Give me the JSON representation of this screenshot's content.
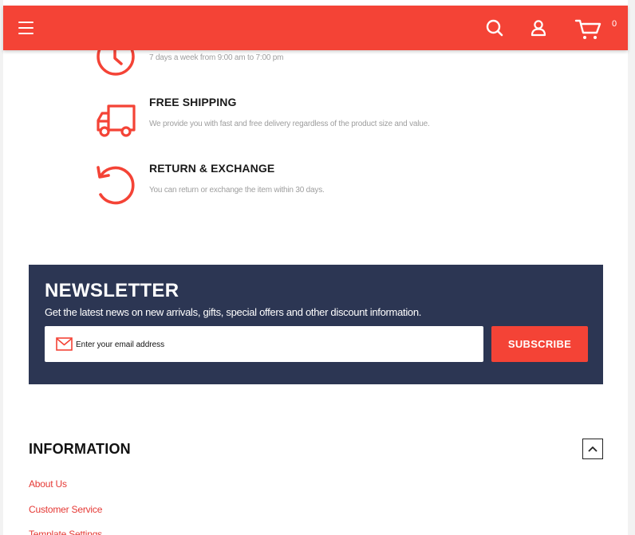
{
  "header": {
    "menu_icon": "hamburger-menu-icon",
    "search_icon": "search-icon",
    "account_icon": "user-icon",
    "cart_icon": "cart-icon",
    "cart_count": "0",
    "accent_color": "#f44336"
  },
  "features": [
    {
      "icon": "clock-icon",
      "title": "",
      "description": "7 days a week from 9:00 am to 7:00 pm"
    },
    {
      "icon": "truck-icon",
      "title": "FREE SHIPPING",
      "description": "We provide you with fast and free delivery regardless of the product size and value."
    },
    {
      "icon": "return-arrow-icon",
      "title": "RETURN & EXCHANGE",
      "description": "You can return or exchange the item within 30 days."
    }
  ],
  "newsletter": {
    "title": "NEWSLETTER",
    "subtitle": "Get the latest news on new arrivals, gifts, special offers and other discount information.",
    "email_placeholder": "Enter your email address",
    "email_value": "",
    "subscribe_label": "SUBSCRIBE",
    "background_color": "#2c3653"
  },
  "information": {
    "title": "INFORMATION",
    "toggle_icon": "chevron-up-icon",
    "links": [
      {
        "label": "About Us"
      },
      {
        "label": "Customer Service"
      },
      {
        "label": "Template Settings"
      }
    ]
  }
}
